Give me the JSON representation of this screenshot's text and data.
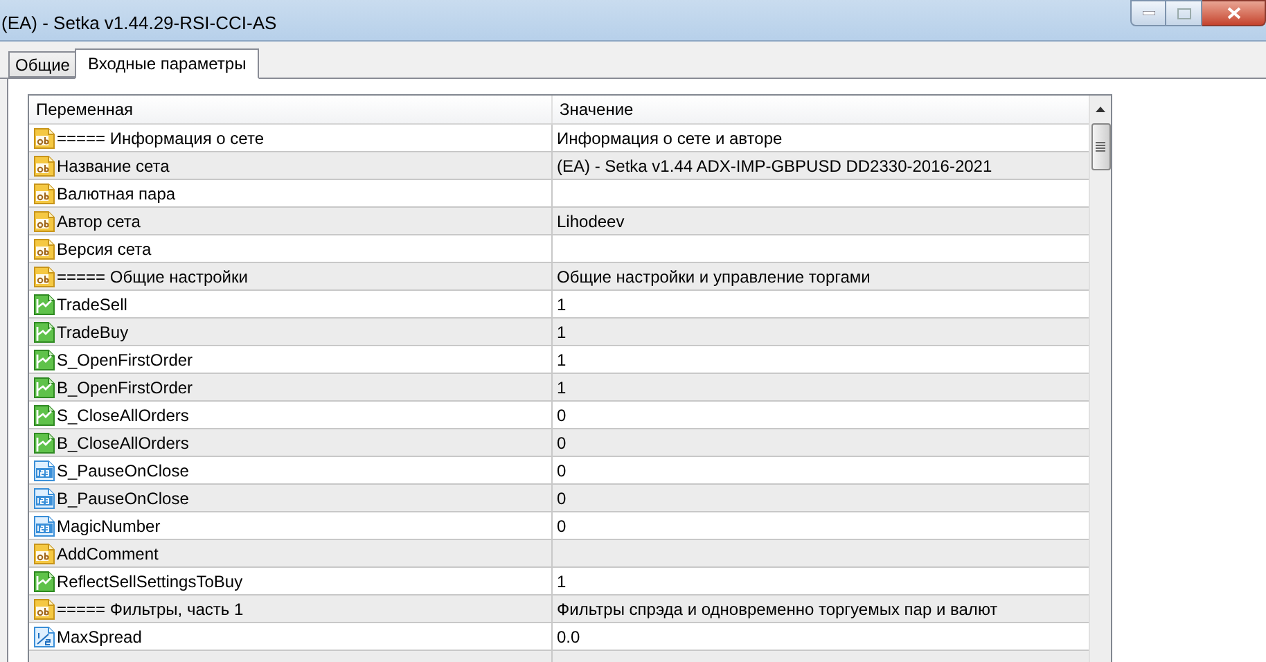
{
  "window": {
    "title": "(EA) - Setka v1.44.29-RSI-CCI-AS"
  },
  "tabs": [
    {
      "label": "Общие",
      "selected": false
    },
    {
      "label": "Входные параметры",
      "selected": true
    }
  ],
  "table": {
    "columns": [
      "Переменная",
      "Значение"
    ],
    "rows": [
      {
        "kind": "string",
        "name": "===== Информация о сете",
        "value": "Информация о сете и авторе"
      },
      {
        "kind": "string",
        "name": "Название сета",
        "value": "(EA) - Setka v1.44 ADX-IMP-GBPUSD DD2330-2016-2021"
      },
      {
        "kind": "string",
        "name": "Валютная пара",
        "value": ""
      },
      {
        "kind": "string",
        "name": "Автор сета",
        "value": "Lihodeev"
      },
      {
        "kind": "string",
        "name": "Версия сета",
        "value": ""
      },
      {
        "kind": "string",
        "name": "===== Общие настройки",
        "value": "Общие настройки и управление торгами"
      },
      {
        "kind": "bool",
        "name": "TradeSell",
        "value": "1"
      },
      {
        "kind": "bool",
        "name": "TradeBuy",
        "value": "1"
      },
      {
        "kind": "bool",
        "name": "S_OpenFirstOrder",
        "value": "1"
      },
      {
        "kind": "bool",
        "name": "B_OpenFirstOrder",
        "value": "1"
      },
      {
        "kind": "bool",
        "name": "S_CloseAllOrders",
        "value": "0"
      },
      {
        "kind": "bool",
        "name": "B_CloseAllOrders",
        "value": "0"
      },
      {
        "kind": "int",
        "name": "S_PauseOnClose",
        "value": "0"
      },
      {
        "kind": "int",
        "name": "B_PauseOnClose",
        "value": "0"
      },
      {
        "kind": "int",
        "name": "MagicNumber",
        "value": "0"
      },
      {
        "kind": "string",
        "name": "AddComment",
        "value": ""
      },
      {
        "kind": "bool",
        "name": "ReflectSellSettingsToBuy",
        "value": "1"
      },
      {
        "kind": "string",
        "name": "===== Фильтры, часть 1",
        "value": "Фильтры спрэда и одновременно торгуемых пар и валют"
      },
      {
        "kind": "double",
        "name": "MaxSpread",
        "value": "0.0"
      }
    ]
  }
}
